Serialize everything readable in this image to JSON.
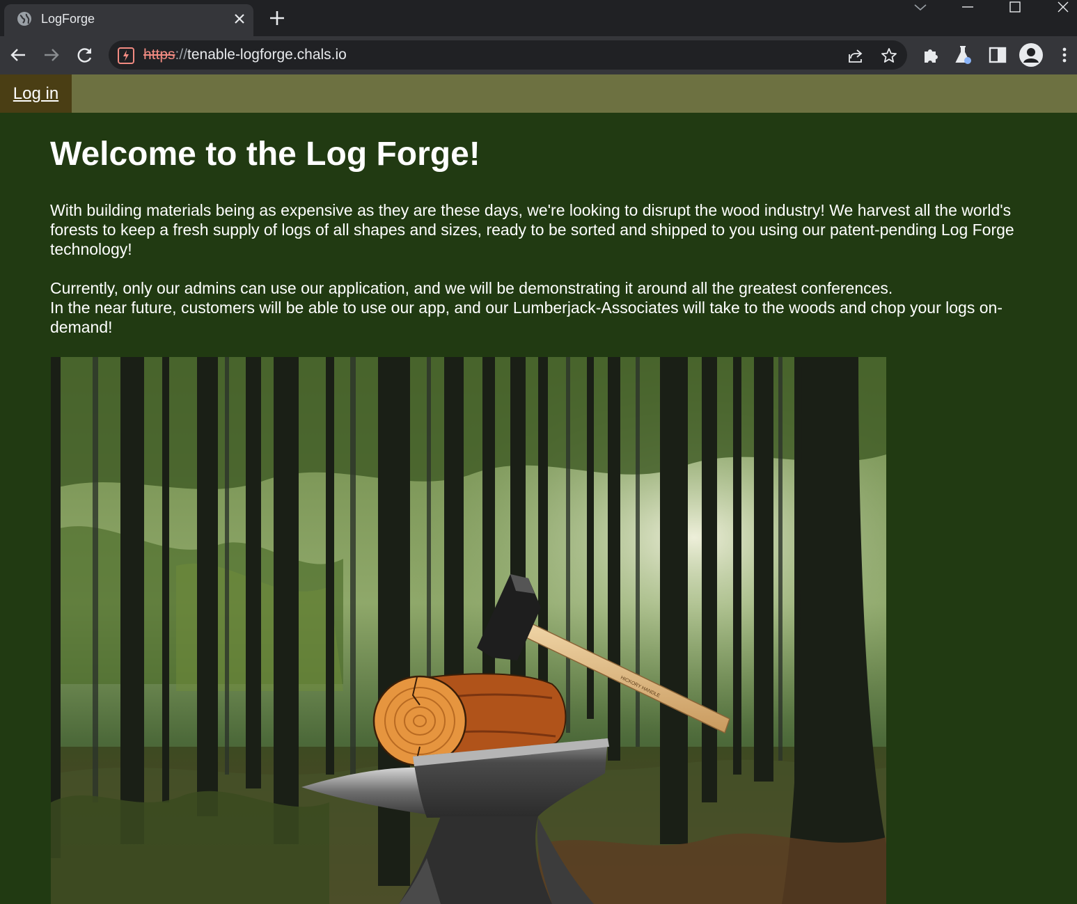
{
  "browser": {
    "tab_title": "LogForge",
    "url_scheme": "https",
    "url_separator": "://",
    "url_host": "tenable-logforge.chals.io"
  },
  "page": {
    "nav": {
      "login_label": "Log in"
    },
    "heading": "Welcome to the Log Forge!",
    "paragraph_1": "With building materials being as expensive as they are these days, we're looking to disrupt the wood industry! We harvest all the world's forests to keep a fresh supply of logs of all shapes and sizes, ready to be sorted and shipped to you using our patent-pending Log Forge technology!",
    "paragraph_2_line_1": "Currently, only our admins can use our application, and we will be demonstrating it around all the greatest conferences.",
    "paragraph_2_line_2": "In the near future, customers will be able to use our app, and our Lumberjack-Associates will take to the woods and chop your logs on-demand!",
    "hero_image": {
      "alt": "",
      "hammer_label": "HICKORY HANDLE"
    }
  },
  "colors": {
    "page_bg": "#213a12",
    "nav_bg": "#6d7141",
    "login_bg": "#4a3e14",
    "text": "#ffffff",
    "chrome_dark": "#202124",
    "chrome_toolbar": "#35363a"
  }
}
